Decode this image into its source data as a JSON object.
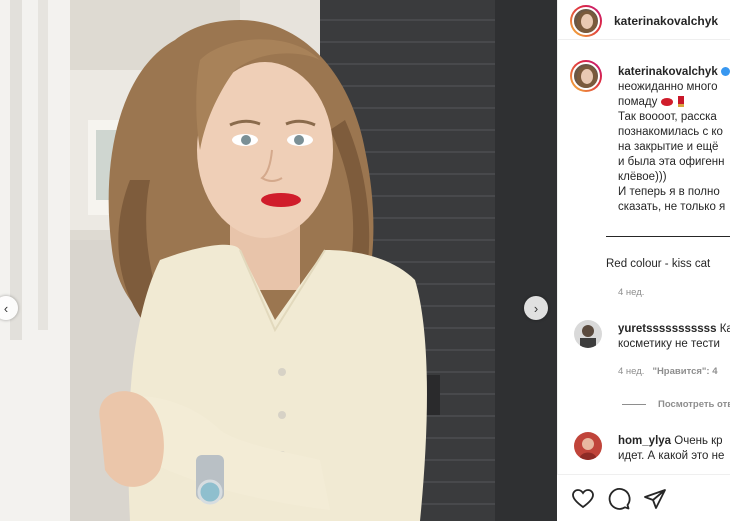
{
  "post": {
    "username": "katerinakovalchyk",
    "caption": {
      "username": "katerinakovalchyk",
      "lines": [
        "неожиданно много",
        "помаду",
        "Так воооот, расска",
        "познакомилась с ко",
        "на закрытие и ещё",
        "и была эта офигенн",
        "клёвое)))",
        "И теперь я в полно",
        "сказать, не только я"
      ],
      "red_colour": "Red colour - kiss cat",
      "time": "4 нед."
    },
    "comments": [
      {
        "username": "yuretsssssssssss",
        "text": "Кате",
        "text2": "косметику не тести",
        "time": "4 нед.",
        "likes": "\"Нравится\": 4"
      },
      {
        "username": "hom_ylya",
        "text": "Очень кр",
        "text2": "идет. А какой это не"
      }
    ],
    "view_replies": "Посмотреть отв"
  },
  "icons": {
    "prev": "chevron-left-icon",
    "next": "chevron-right-icon",
    "like": "heart-icon",
    "comment": "comment-icon",
    "share": "paper-plane-icon",
    "verified": "verified-badge-icon"
  },
  "colors": {
    "accent": "#3897f0",
    "meta": "#8e8e8e",
    "text": "#262626"
  }
}
